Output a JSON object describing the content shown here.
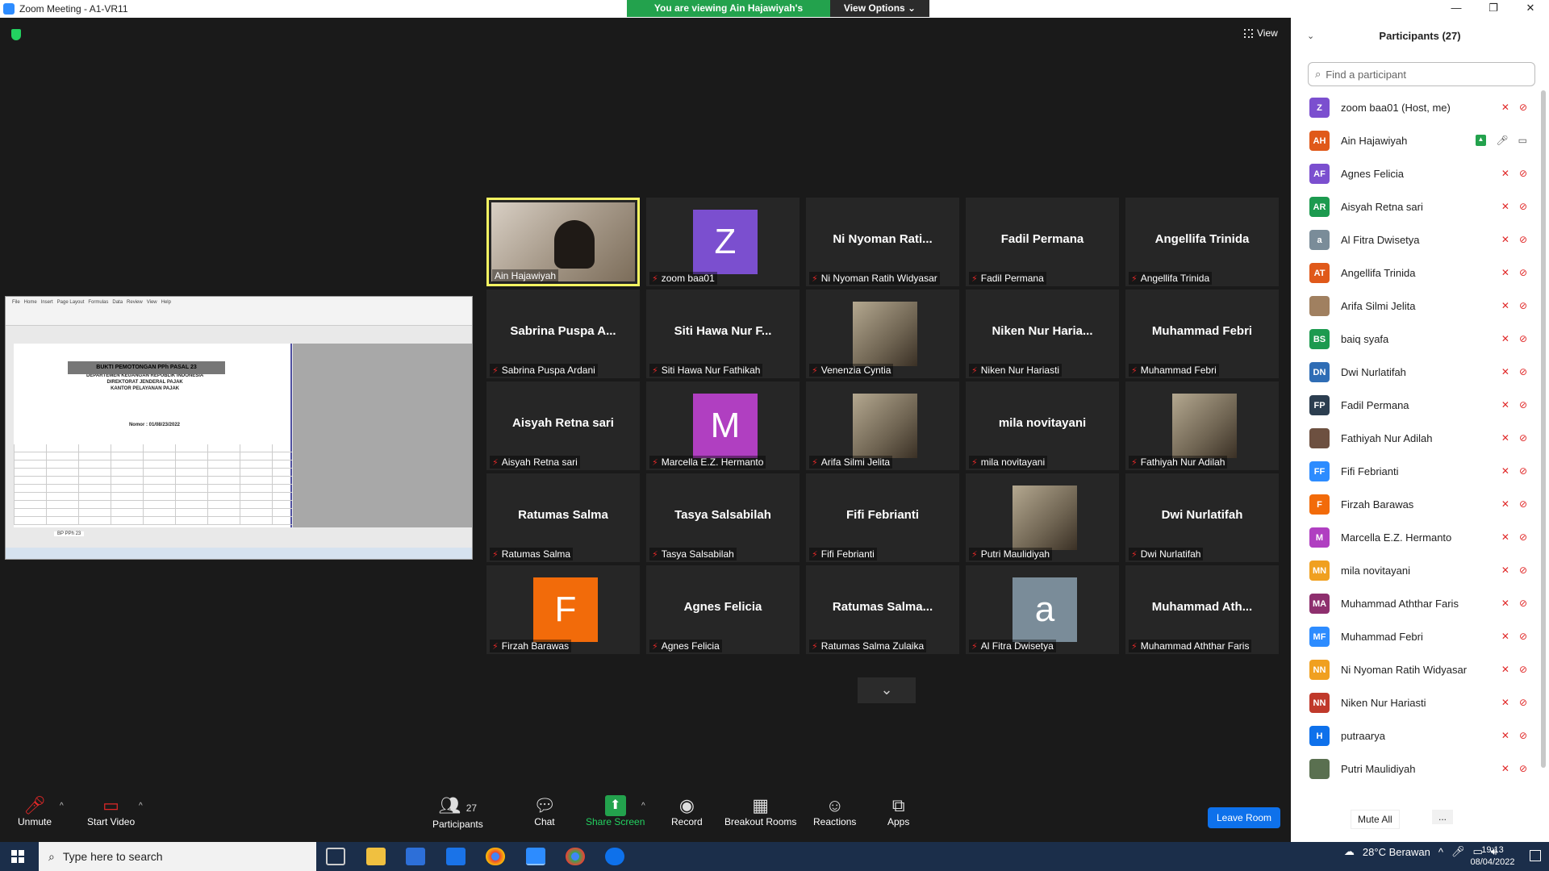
{
  "window": {
    "title": "Zoom Meeting - A1-VR11",
    "controls": [
      "—",
      "❐",
      "✕"
    ]
  },
  "banner": {
    "message": "You are viewing Ain Hajawiyah's screen",
    "view_options": "View Options ⌄"
  },
  "view_button": "View",
  "shared_screen": {
    "sheet_title": "BUKTI PEMOTONGAN PPh PASAL 23",
    "header_lines": [
      "DEPARTEMEN KEUANGAN REPUBLIK INDONESIA",
      "DIREKTORAT JENDERAL PAJAK",
      "KANTOR PELAYANAN PAJAK"
    ],
    "nomor": "Nomor : 01/08/23/2022",
    "tab": "BP PPh 23"
  },
  "tiles": [
    {
      "display": "video",
      "label": "Ain Hajawiyah",
      "active": true
    },
    {
      "display": "avatar",
      "letter": "Z",
      "color": "#7b4fcf",
      "label": "zoom baa01"
    },
    {
      "display": "name",
      "center": "Ni Nyoman Rati...",
      "label": "Ni Nyoman Ratih Widyasar"
    },
    {
      "display": "name",
      "center": "Fadil Permana",
      "label": "Fadil Permana"
    },
    {
      "display": "name",
      "center": "Angellifa Trinida",
      "label": "Angellifa Trinida"
    },
    {
      "display": "name",
      "center": "Sabrina Puspa A...",
      "label": "Sabrina Puspa Ardani"
    },
    {
      "display": "name",
      "center": "Siti Hawa Nur F...",
      "label": "Siti Hawa Nur Fathikah"
    },
    {
      "display": "photo",
      "label": "Venenzia Cyntia"
    },
    {
      "display": "name",
      "center": "Niken Nur Haria...",
      "label": "Niken Nur Hariasti"
    },
    {
      "display": "name",
      "center": "Muhammad Febri",
      "label": "Muhammad Febri"
    },
    {
      "display": "name",
      "center": "Aisyah Retna sari",
      "label": "Aisyah Retna sari"
    },
    {
      "display": "avatar",
      "letter": "M",
      "color": "#b03fc1",
      "label": "Marcella E.Z. Hermanto"
    },
    {
      "display": "photo",
      "label": "Arifa Silmi Jelita"
    },
    {
      "display": "name",
      "center": "mila novitayani",
      "label": "mila novitayani"
    },
    {
      "display": "photo",
      "label": "Fathiyah Nur Adilah"
    },
    {
      "display": "name",
      "center": "Ratumas Salma",
      "label": "Ratumas Salma"
    },
    {
      "display": "name",
      "center": "Tasya Salsabilah",
      "label": "Tasya Salsabilah"
    },
    {
      "display": "name",
      "center": "Fifi Febrianti",
      "label": "Fifi Febrianti"
    },
    {
      "display": "photo",
      "label": "Putri Maulidiyah"
    },
    {
      "display": "name",
      "center": "Dwi Nurlatifah",
      "label": "Dwi Nurlatifah"
    },
    {
      "display": "avatar",
      "letter": "F",
      "color": "#f26b0a",
      "label": "Firzah Barawas"
    },
    {
      "display": "name",
      "center": "Agnes Felicia",
      "label": "Agnes Felicia"
    },
    {
      "display": "name",
      "center": "Ratumas Salma...",
      "label": "Ratumas Salma Zulaika"
    },
    {
      "display": "avatar",
      "letter": "a",
      "color": "#7a8c99",
      "label": "Al Fitra Dwisetya"
    },
    {
      "display": "name",
      "center": "Muhammad Ath...",
      "label": "Muhammad Aththar Faris"
    }
  ],
  "toolbar": {
    "unmute": "Unmute",
    "start_video": "Start Video",
    "participants": "Participants",
    "participants_count": "27",
    "chat": "Chat",
    "share_screen": "Share Screen",
    "record": "Record",
    "breakout_rooms": "Breakout Rooms",
    "reactions": "Reactions",
    "apps": "Apps",
    "leave": "Leave Room"
  },
  "panel": {
    "title": "Participants (27)",
    "search_placeholder": "Find a participant",
    "mute_all": "Mute All",
    "more": "...",
    "people": [
      {
        "initials": "Z",
        "color": "#7b4fcf",
        "name": "zoom baa01 (Host, me)"
      },
      {
        "initials": "AH",
        "color": "#e0591a",
        "name": "Ain Hajawiyah",
        "sharing": true
      },
      {
        "initials": "AF",
        "color": "#7b4fcf",
        "name": "Agnes Felicia"
      },
      {
        "initials": "AR",
        "color": "#1c9a4f",
        "name": "Aisyah Retna sari"
      },
      {
        "initials": "a",
        "color": "#7a8c99",
        "name": "Al Fitra Dwisetya"
      },
      {
        "initials": "AT",
        "color": "#e0591a",
        "name": "Angellifa Trinida"
      },
      {
        "initials": "",
        "color": "#a08060",
        "name": "Arifa Silmi Jelita"
      },
      {
        "initials": "BS",
        "color": "#1c9a4f",
        "name": "baiq syafa"
      },
      {
        "initials": "DN",
        "color": "#2f6db5",
        "name": "Dwi Nurlatifah"
      },
      {
        "initials": "FP",
        "color": "#2c3e50",
        "name": "Fadil Permana"
      },
      {
        "initials": "",
        "color": "#6d5040",
        "name": "Fathiyah Nur Adilah"
      },
      {
        "initials": "FF",
        "color": "#2d8cff",
        "name": "Fifi Febrianti"
      },
      {
        "initials": "F",
        "color": "#f26b0a",
        "name": "Firzah Barawas"
      },
      {
        "initials": "M",
        "color": "#b03fc1",
        "name": "Marcella E.Z. Hermanto"
      },
      {
        "initials": "MN",
        "color": "#f0a020",
        "name": "mila novitayani"
      },
      {
        "initials": "MA",
        "color": "#8e2f6e",
        "name": "Muhammad Aththar Faris"
      },
      {
        "initials": "MF",
        "color": "#2d8cff",
        "name": "Muhammad Febri"
      },
      {
        "initials": "NN",
        "color": "#f0a020",
        "name": "Ni Nyoman Ratih Widyasar"
      },
      {
        "initials": "NN",
        "color": "#c0392b",
        "name": "Niken Nur Hariasti"
      },
      {
        "initials": "H",
        "color": "#0e71eb",
        "name": "putraarya"
      },
      {
        "initials": "",
        "color": "#5a7050",
        "name": "Putri Maulidiyah"
      }
    ]
  },
  "taskbar": {
    "search_placeholder": "Type here to search",
    "weather": "28°C Berawan",
    "time": "19:13",
    "date": "08/04/2022"
  }
}
